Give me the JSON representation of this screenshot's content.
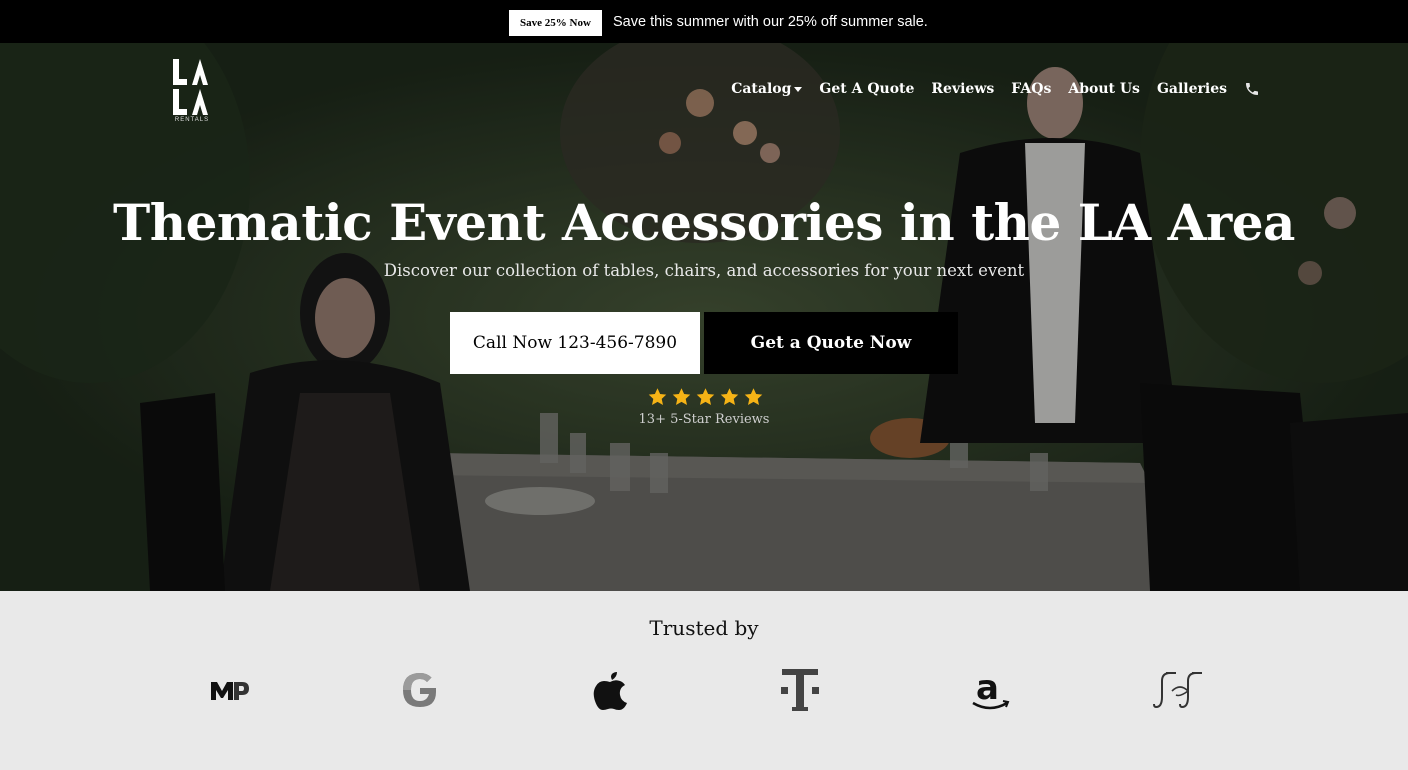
{
  "promo": {
    "button_label": "Save 25% Now",
    "text": "Save this summer with our 25% off summer sale."
  },
  "logo": {
    "letters": "LA LA",
    "subtitle": "RENTALS"
  },
  "nav": {
    "items": [
      {
        "label": "Catalog",
        "dropdown": true
      },
      {
        "label": "Get A Quote"
      },
      {
        "label": "Reviews"
      },
      {
        "label": "FAQs"
      },
      {
        "label": "About Us"
      },
      {
        "label": "Galleries"
      }
    ],
    "phone_icon": "phone-icon"
  },
  "hero": {
    "title": "Thematic Event Accessories in the LA Area",
    "subtitle": "Discover our collection of tables, chairs, and accessories for your next event",
    "call_button": "Call Now 123-456-7890",
    "quote_button": "Get a Quote Now",
    "rating_stars": 5,
    "reviews_text": "13+ 5-Star Reviews"
  },
  "trusted": {
    "title": "Trusted by",
    "brands": [
      "mp-logo",
      "google-logo",
      "apple-logo",
      "t-mobile-logo",
      "amazon-logo",
      "johnson-johnson-logo"
    ]
  },
  "colors": {
    "promo_bg": "#000000",
    "star": "#f5b316",
    "trusted_bg": "#e9e9e9"
  }
}
